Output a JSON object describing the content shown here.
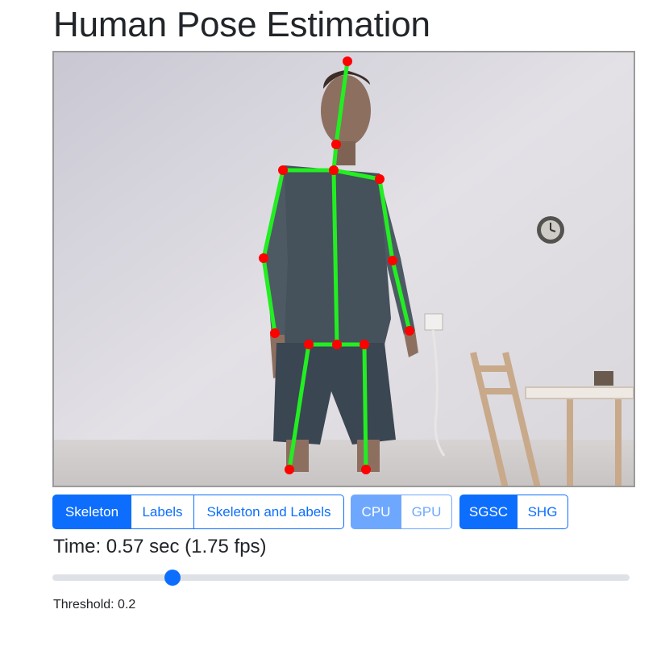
{
  "page": {
    "title": "Human Pose Estimation"
  },
  "view_modes": [
    {
      "label": "Skeleton",
      "active": true
    },
    {
      "label": "Labels",
      "active": false
    },
    {
      "label": "Skeleton and Labels",
      "active": false
    }
  ],
  "device": [
    {
      "label": "CPU",
      "active": true
    },
    {
      "label": "GPU",
      "active": false
    }
  ],
  "model": [
    {
      "label": "SGSC",
      "active": true
    },
    {
      "label": "SHG",
      "active": false
    }
  ],
  "timing": {
    "text": "Time: 0.57 sec (1.75 fps)"
  },
  "threshold": {
    "label": "Threshold: 0.2",
    "value": 0.2,
    "slider_fraction": 0.2
  },
  "colors": {
    "skeleton_line": "#22ee22",
    "keypoint": "#ff0000",
    "accent": "#0d6efd",
    "accent_disabled": "#6ea8fe"
  },
  "icons": {
    "wall_clock": "wall-clock-icon"
  }
}
